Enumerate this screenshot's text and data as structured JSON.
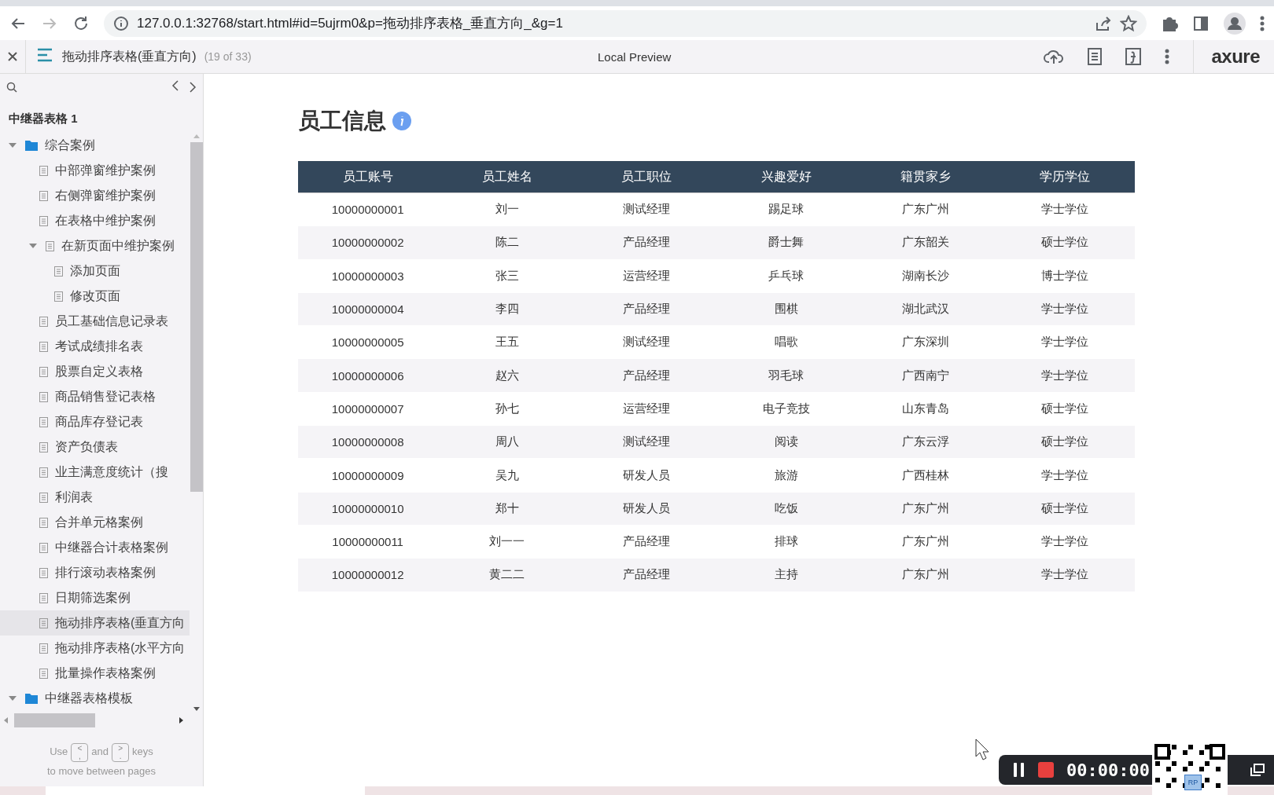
{
  "browser": {
    "url": "127.0.0.1:32768/start.html#id=5ujrm0&p=拖动排序表格_垂直方向_&g=1"
  },
  "toolbar": {
    "page_title": "拖动排序表格(垂直方向)",
    "page_count": "(19 of 33)",
    "center_label": "Local Preview",
    "logo": "axure"
  },
  "sidebar": {
    "project": "中继器表格 1",
    "tree": [
      {
        "kind": "folder",
        "label": "综合案例",
        "expanded": true,
        "selected": false,
        "children": [
          {
            "kind": "page",
            "label": "中部弹窗维护案例",
            "selected": false
          },
          {
            "kind": "page",
            "label": "右侧弹窗维护案例",
            "selected": false
          },
          {
            "kind": "page",
            "label": "在表格中维护案例",
            "selected": false
          },
          {
            "kind": "page",
            "label": "在新页面中维护案例",
            "expanded": true,
            "selected": false,
            "children": [
              {
                "kind": "page",
                "label": "添加页面",
                "selected": false
              },
              {
                "kind": "page",
                "label": "修改页面",
                "selected": false
              }
            ]
          },
          {
            "kind": "page",
            "label": "员工基础信息记录表",
            "selected": false
          },
          {
            "kind": "page",
            "label": "考试成绩排名表",
            "selected": false
          },
          {
            "kind": "page",
            "label": "股票自定义表格",
            "selected": false
          },
          {
            "kind": "page",
            "label": "商品销售登记表格",
            "selected": false
          },
          {
            "kind": "page",
            "label": "商品库存登记表",
            "selected": false
          },
          {
            "kind": "page",
            "label": "资产负债表",
            "selected": false
          },
          {
            "kind": "page",
            "label": "业主满意度统计（搜",
            "selected": false
          },
          {
            "kind": "page",
            "label": "利润表",
            "selected": false
          },
          {
            "kind": "page",
            "label": "合并单元格案例",
            "selected": false
          },
          {
            "kind": "page",
            "label": "中继器合计表格案例",
            "selected": false
          },
          {
            "kind": "page",
            "label": "排行滚动表格案例",
            "selected": false
          },
          {
            "kind": "page",
            "label": "日期筛选案例",
            "selected": false
          },
          {
            "kind": "page",
            "label": "拖动排序表格(垂直方向",
            "selected": true
          },
          {
            "kind": "page",
            "label": "拖动排序表格(水平方向",
            "selected": false
          },
          {
            "kind": "page",
            "label": "批量操作表格案例",
            "selected": false
          }
        ]
      },
      {
        "kind": "folder",
        "label": "中继器表格模板",
        "expanded": true,
        "selected": false
      }
    ],
    "hint": {
      "use": "Use",
      "prev_key": [
        "<",
        ","
      ],
      "and": "and",
      "next_key": [
        ">",
        "."
      ],
      "keys": "keys",
      "line2": "to move between pages"
    }
  },
  "content": {
    "title": "员工信息",
    "columns": [
      "员工账号",
      "员工姓名",
      "员工职位",
      "兴趣爱好",
      "籍贯家乡",
      "学历学位"
    ],
    "rows": [
      [
        "10000000001",
        "刘一",
        "测试经理",
        "踢足球",
        "广东广州",
        "学士学位"
      ],
      [
        "10000000002",
        "陈二",
        "产品经理",
        "爵士舞",
        "广东韶关",
        "硕士学位"
      ],
      [
        "10000000003",
        "张三",
        "运营经理",
        "乒乓球",
        "湖南长沙",
        "博士学位"
      ],
      [
        "10000000004",
        "李四",
        "产品经理",
        "围棋",
        "湖北武汉",
        "学士学位"
      ],
      [
        "10000000005",
        "王五",
        "测试经理",
        "唱歌",
        "广东深圳",
        "学士学位"
      ],
      [
        "10000000006",
        "赵六",
        "产品经理",
        "羽毛球",
        "广西南宁",
        "学士学位"
      ],
      [
        "10000000007",
        "孙七",
        "运营经理",
        "电子竞技",
        "山东青岛",
        "硕士学位"
      ],
      [
        "10000000008",
        "周八",
        "测试经理",
        "阅读",
        "广东云浮",
        "硕士学位"
      ],
      [
        "10000000009",
        "吴九",
        "研发人员",
        "旅游",
        "广西桂林",
        "学士学位"
      ],
      [
        "10000000010",
        "郑十",
        "研发人员",
        "吃饭",
        "广东广州",
        "硕士学位"
      ],
      [
        "10000000011",
        "刘一一",
        "产品经理",
        "排球",
        "广东广州",
        "学士学位"
      ],
      [
        "10000000012",
        "黄二二",
        "产品经理",
        "主持",
        "广东广州",
        "学士学位"
      ]
    ]
  },
  "recorder": {
    "timer": "00:00:00",
    "qr_badge": "RP"
  }
}
